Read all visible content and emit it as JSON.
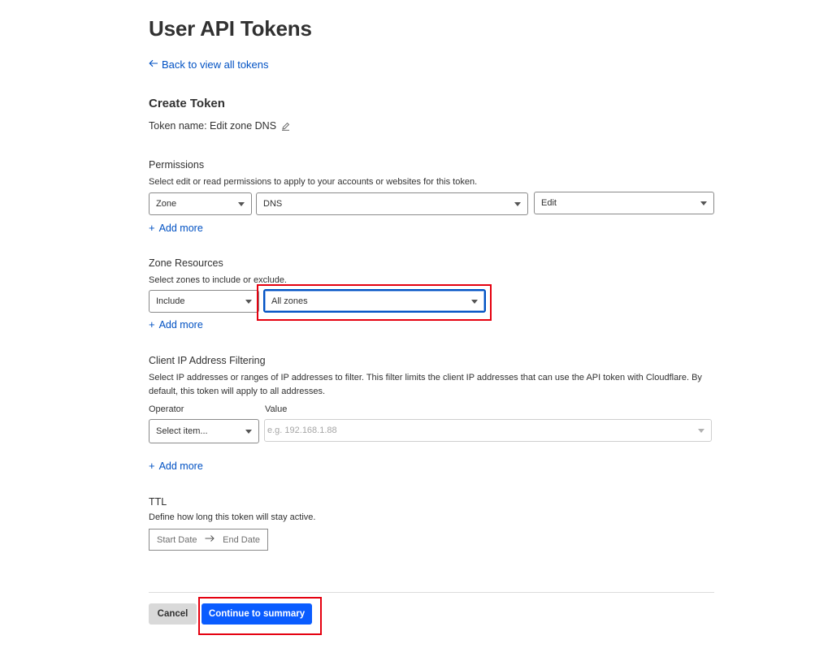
{
  "page": {
    "title": "User API Tokens",
    "back_link": "Back to view all tokens"
  },
  "create": {
    "heading": "Create Token",
    "token_name_label": "Token name: Edit zone DNS"
  },
  "permissions": {
    "heading": "Permissions",
    "description": "Select edit or read permissions to apply to your accounts or websites for this token.",
    "scope": "Zone",
    "resource": "DNS",
    "access": "Edit",
    "add_more": "Add more"
  },
  "zone_resources": {
    "heading": "Zone Resources",
    "description": "Select zones to include or exclude.",
    "mode": "Include",
    "target": "All zones",
    "add_more": "Add more"
  },
  "ip_filtering": {
    "heading": "Client IP Address Filtering",
    "description": "Select IP addresses or ranges of IP addresses to filter. This filter limits the client IP addresses that can use the API token with Cloudflare. By default, this token will apply to all addresses.",
    "operator_label": "Operator",
    "value_label": "Value",
    "operator_placeholder": "Select item...",
    "value_placeholder": "e.g. 192.168.1.88",
    "add_more": "Add more"
  },
  "ttl": {
    "heading": "TTL",
    "description": "Define how long this token will stay active.",
    "start_date": "Start Date",
    "end_date": "End Date"
  },
  "actions": {
    "cancel": "Cancel",
    "continue": "Continue to summary"
  },
  "colors": {
    "link": "#0051c3",
    "primary_button": "#0a5cff",
    "highlight": "#e5000f"
  },
  "icons": {
    "back": "arrow-left-icon",
    "edit": "pencil-icon",
    "add": "plus-icon",
    "dropdown": "caret-down-icon",
    "date_range": "arrow-right-icon"
  }
}
